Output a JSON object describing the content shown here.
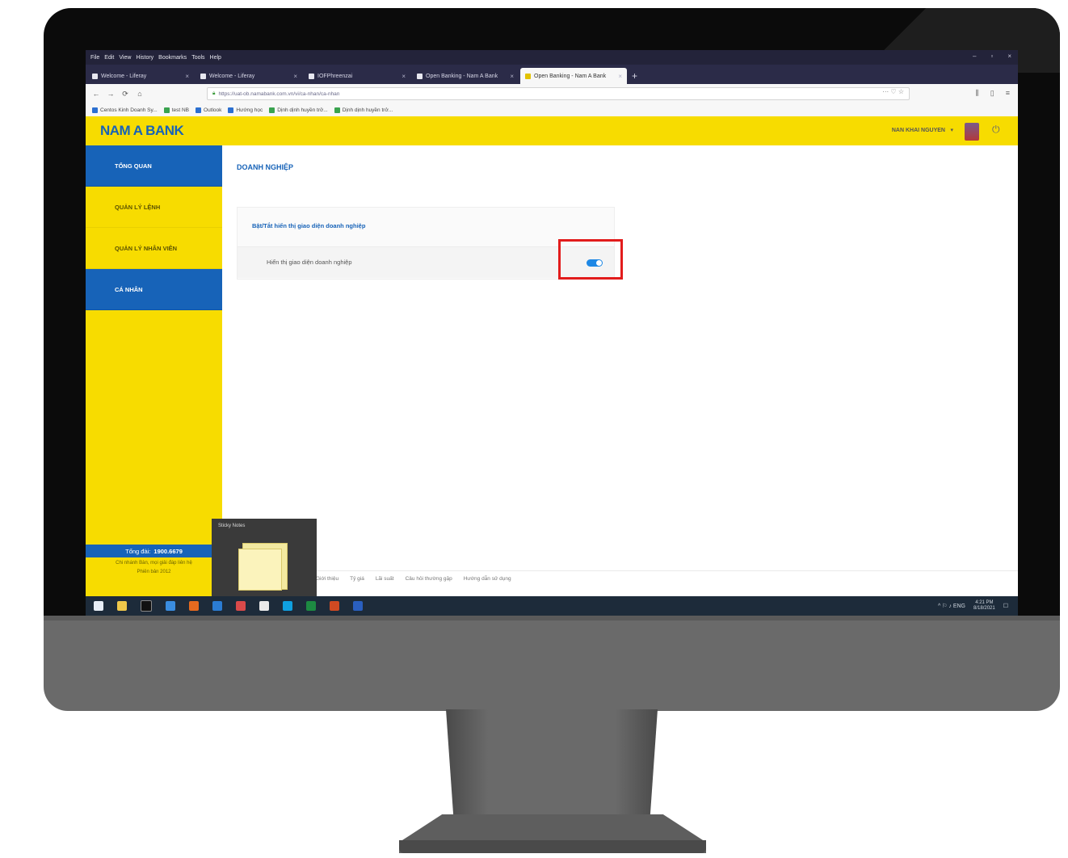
{
  "browser": {
    "menu": [
      "File",
      "Edit",
      "View",
      "History",
      "Bookmarks",
      "Tools",
      "Help"
    ],
    "window_controls": [
      "–",
      "▫",
      "×"
    ],
    "tabs": [
      {
        "label": "Welcome - Liferay",
        "active": false
      },
      {
        "label": "Welcome - Liferay",
        "active": false
      },
      {
        "label": "IOFPhreenzai",
        "active": false
      },
      {
        "label": "Open Banking - Nam A Bank",
        "active": false
      },
      {
        "label": "Open Banking - Nam A Bank",
        "active": true
      }
    ],
    "new_tab": "+",
    "nav": {
      "back": "←",
      "forward": "→",
      "reload": "⟳",
      "home": "⌂"
    },
    "url": "https://uat-ob.namabank.com.vn/vi/ca-nhan/ca-nhan",
    "url_actions": "··· ♡ ☆",
    "bookmarks": [
      {
        "label": "Centos Kinh Doanh Sy...",
        "color": "blue"
      },
      {
        "label": "test NB",
        "color": "green"
      },
      {
        "label": "Outlook",
        "color": "blue"
      },
      {
        "label": "Hướng học",
        "color": "blue"
      },
      {
        "label": "Dịnh dịnh huyền trở...",
        "color": "green"
      },
      {
        "label": "Dịnh dịnh huyền trở...",
        "color": "green"
      }
    ]
  },
  "app": {
    "brand": "NAM A BANK",
    "user": "NAN KHAI NGUYEN",
    "user_caret": "▾",
    "power": "⏻",
    "sidebar": [
      {
        "label": "TỔNG QUAN",
        "active": true
      },
      {
        "label": "QUẢN LÝ LỆNH",
        "active": false
      },
      {
        "label": "QUẢN LÝ NHÂN VIÊN",
        "active": false
      },
      {
        "label": "CÁ NHÂN",
        "active": true
      }
    ],
    "hotline_label": "Tổng đài:",
    "hotline_number": "1900.6679",
    "address_line1": "Chi nhánh Bàn, mọi giải đáp liên hệ",
    "address_line2": "Phiên bản 2012",
    "page_title": "DOANH NGHIỆP",
    "panel_title": "Bật/Tắt hiển thị giao diện doanh nghiệp",
    "row_label": "Hiển thị giao diện doanh nghiệp",
    "toggle_on": true,
    "footer": [
      "Giới thiệu",
      "Tỷ giá",
      "Lãi suất",
      "Câu hỏi thường gặp",
      "Hướng dẫn sử dụng"
    ]
  },
  "taskbar": {
    "popup_title": "Sticky Notes",
    "tray": "^ ⚐ ♪ ENG",
    "clock_time": "4:21 PM",
    "clock_date": "8/18/2021",
    "notify": "☐"
  },
  "colors": {
    "brand_yellow": "#f7dc00",
    "brand_blue": "#1763b8",
    "highlight": "#e21c1c",
    "toggle": "#1e88e5"
  }
}
